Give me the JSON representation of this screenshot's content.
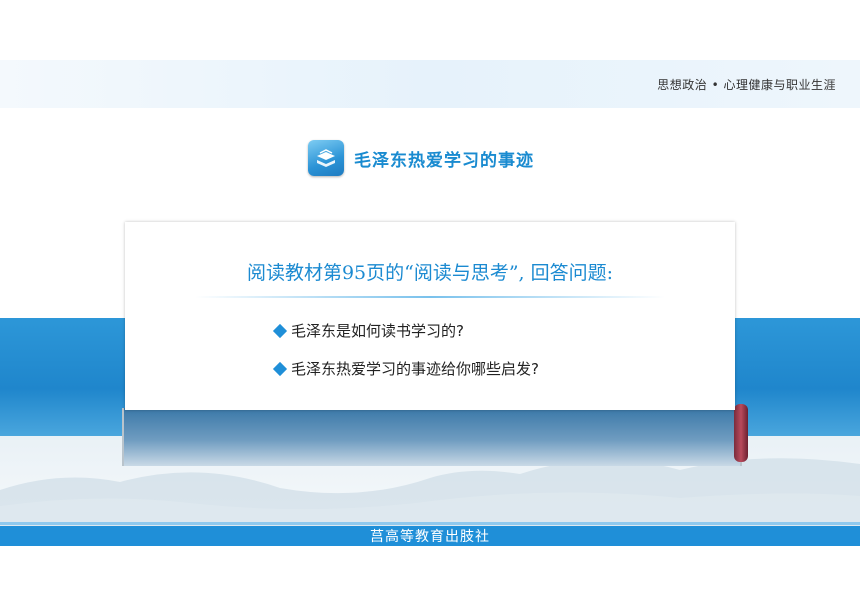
{
  "header": {
    "subject_tag": "思想政治 • 心理健康与职业生涯"
  },
  "section": {
    "icon": "book-stack-icon",
    "title": "毛泽东热爱学习的事迹"
  },
  "card": {
    "heading": "阅读教材第95页的“阅读与思考”, 回答问题:",
    "questions": [
      "毛泽东是如何读书学习的?",
      "毛泽东热爱学习的事迹给你哪些启发?"
    ]
  },
  "footer": {
    "publisher": "莒高等教育出肢社"
  },
  "colors": {
    "accent": "#1b8ad1",
    "band": "#1f8fd8"
  }
}
